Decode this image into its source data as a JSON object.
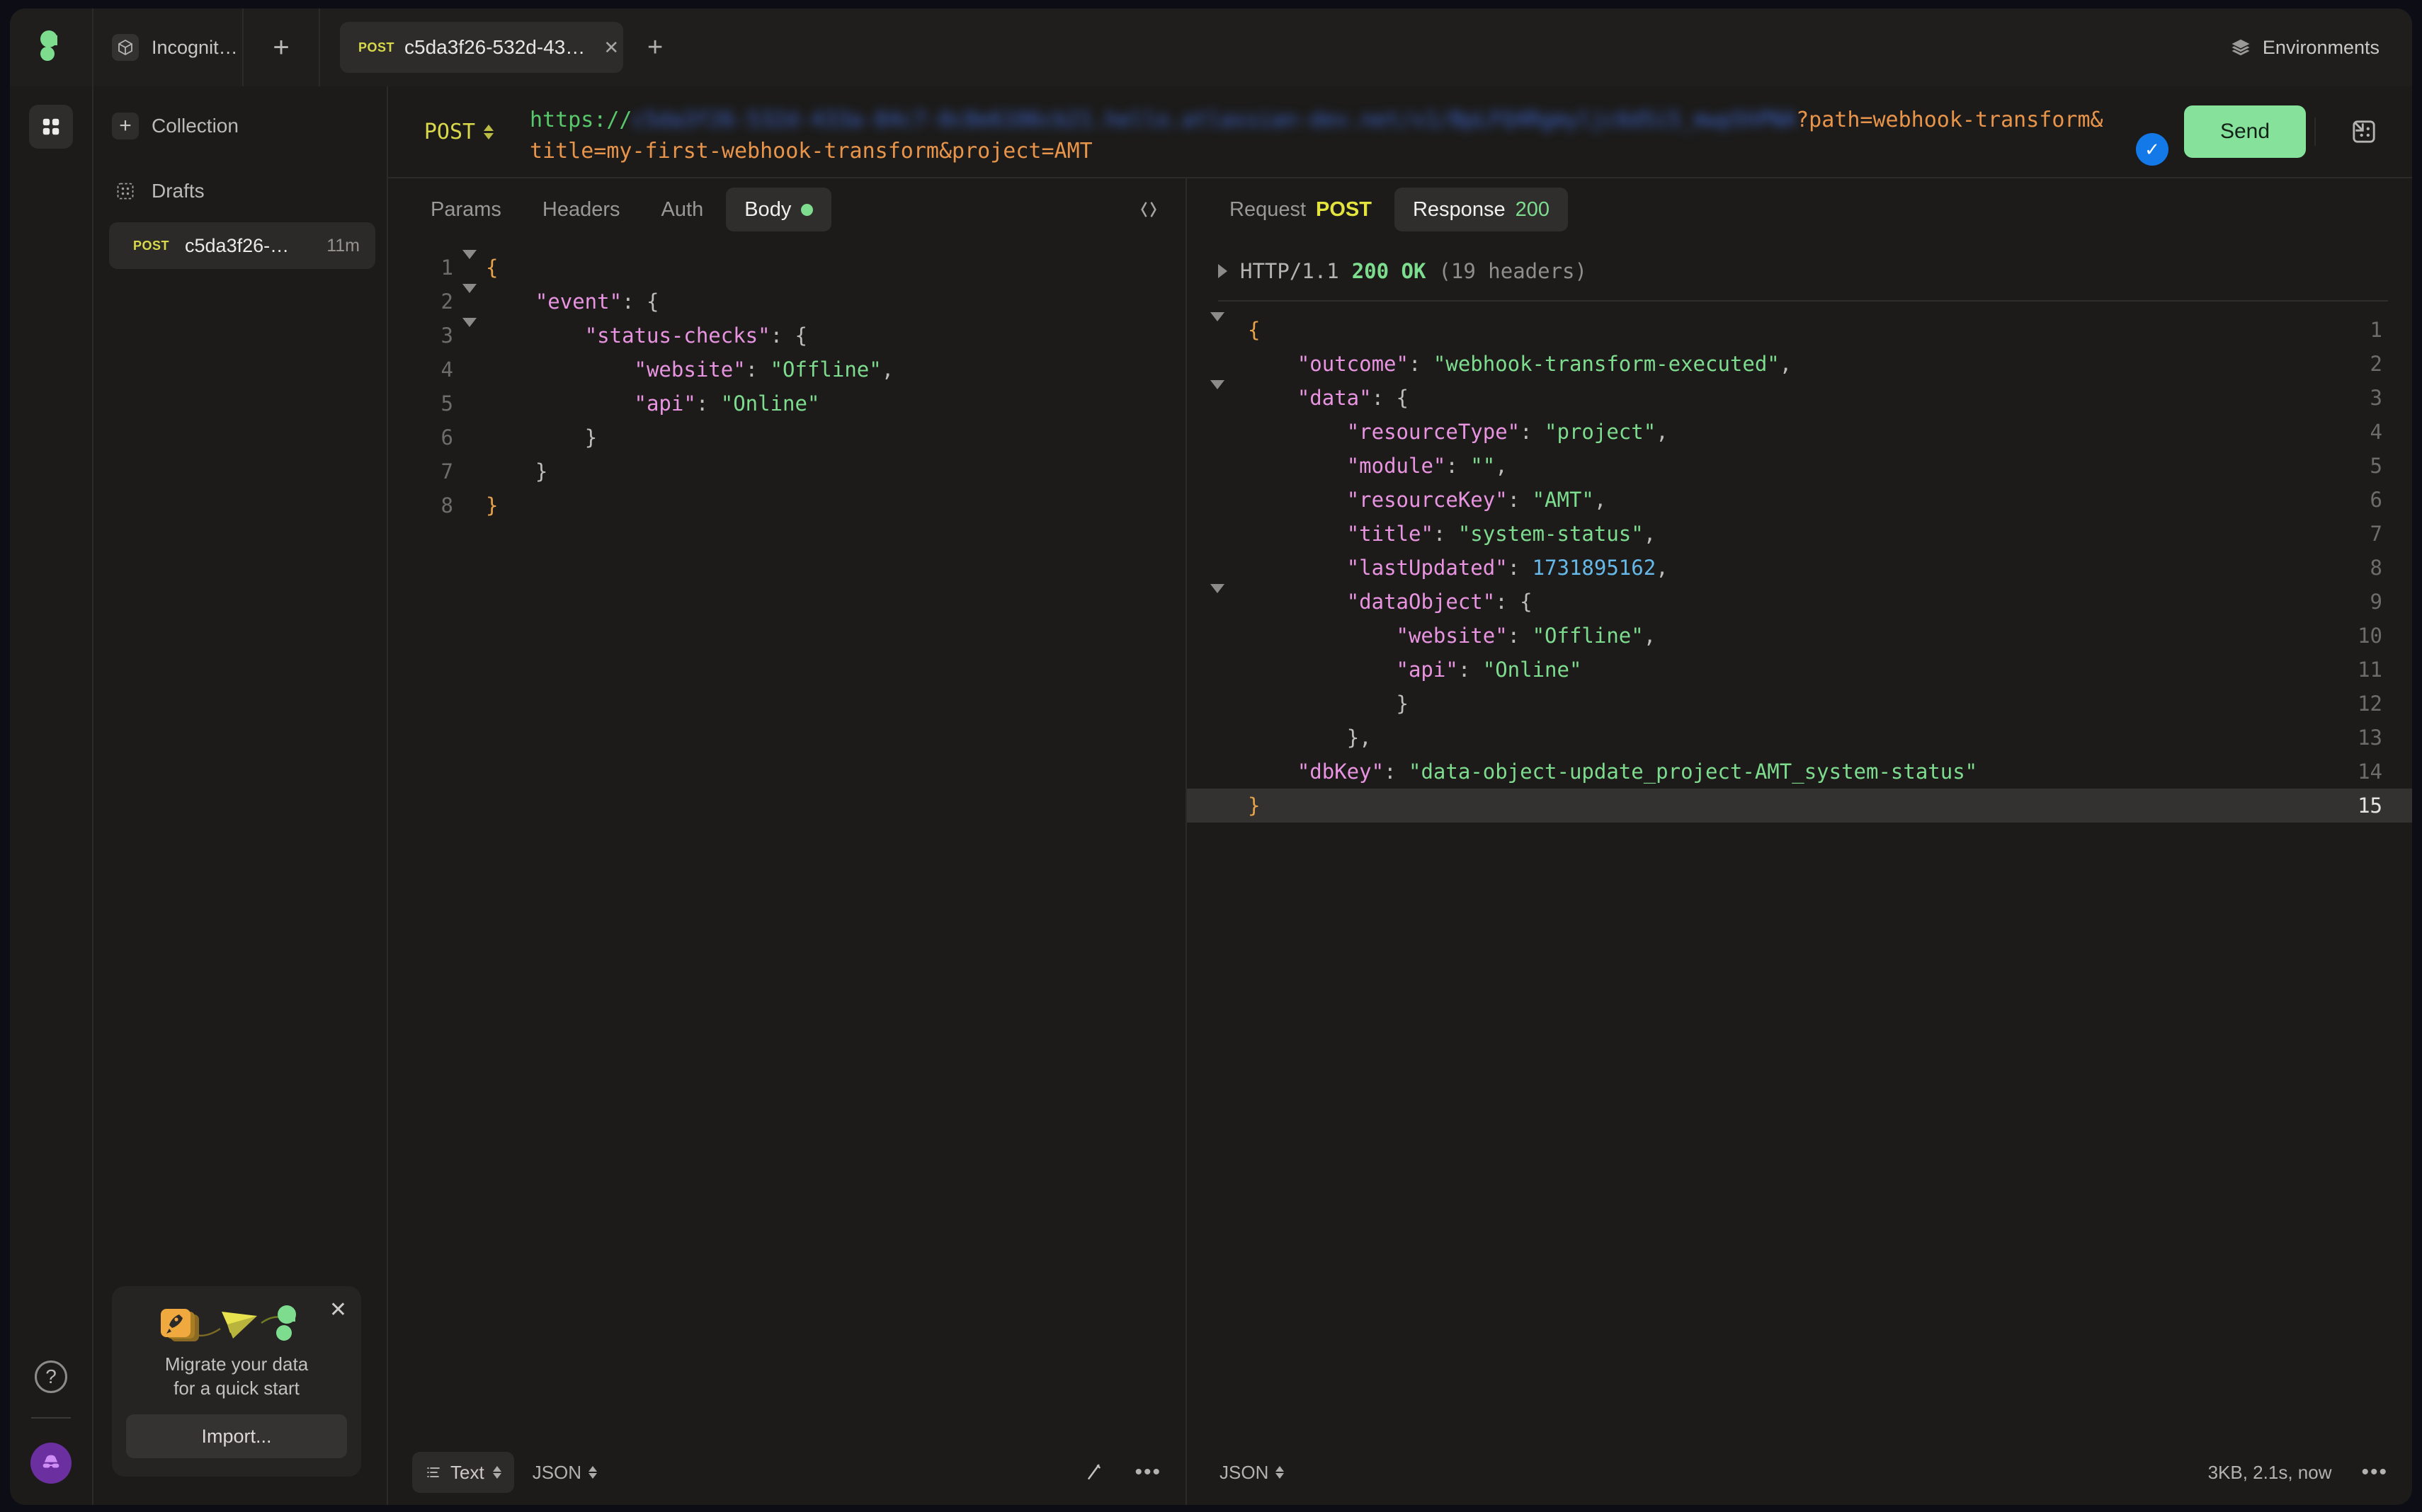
{
  "app": {
    "workspace_tab": "Incognito s...",
    "new_workspace_icon": "plus-icon",
    "environments_label": "Environments",
    "environments_icon": "layers-icon"
  },
  "request_tabs": {
    "tabs": [
      {
        "method": "POST",
        "title": "c5da3f26-532d-43…",
        "close_icon": "close-icon"
      }
    ],
    "new_tab_icon": "plus-icon"
  },
  "sidebar": {
    "new_collection_label": "Collection",
    "new_collection_icon": "plus-icon",
    "drafts_label": "Drafts",
    "drafts_icon": "drafts-grid-icon",
    "drafts": [
      {
        "method": "POST",
        "title": "c5da3f26-…",
        "age": "11m"
      }
    ],
    "migrate_card": {
      "close_icon": "close-icon",
      "line1": "Migrate your data",
      "line2": "for a quick start",
      "button": "Import..."
    }
  },
  "rail": {
    "apps_icon": "grid-apps-icon",
    "help_icon": "help-circle-icon",
    "avatar_icon": "incognito-avatar-icon"
  },
  "url_bar": {
    "method": "POST",
    "method_stepper_icon": "stepper-icon",
    "scheme": "https://",
    "host_redacted": "c5da3f26-532d-433a-84c7-0c8e6106cb21.hello.atlassian-dev.net/x1/BpLFQ4Rgmyljc6d5i5_mwp5hPNA",
    "query": "?path=webhook-transform&title=my-first-webhook-transform&project=AMT",
    "validation_icon": "check-circle-icon",
    "send_label": "Send",
    "split_view_icon": "split-panel-icon"
  },
  "request_pane": {
    "tabs": [
      {
        "label": "Params",
        "active": false
      },
      {
        "label": "Headers",
        "active": false
      },
      {
        "label": "Auth",
        "active": false
      },
      {
        "label": "Body",
        "active": true,
        "badge": "dot-green"
      }
    ],
    "code_icon": "code-brackets-icon",
    "body_lines": [
      {
        "num": "1",
        "fold": "down",
        "indent": 0,
        "tokens": [
          {
            "t": "{",
            "c": "b1"
          }
        ]
      },
      {
        "num": "2",
        "fold": "down",
        "indent": 1,
        "tokens": [
          {
            "t": "\"event\"",
            "c": "k"
          },
          {
            "t": ": ",
            "c": "p"
          },
          {
            "t": "{",
            "c": "p"
          }
        ]
      },
      {
        "num": "3",
        "fold": "down",
        "indent": 2,
        "tokens": [
          {
            "t": "\"status-checks\"",
            "c": "k"
          },
          {
            "t": ": ",
            "c": "p"
          },
          {
            "t": "{",
            "c": "p"
          }
        ]
      },
      {
        "num": "4",
        "fold": "",
        "indent": 3,
        "tokens": [
          {
            "t": "\"website\"",
            "c": "k"
          },
          {
            "t": ": ",
            "c": "p"
          },
          {
            "t": "\"Offline\"",
            "c": "s"
          },
          {
            "t": ",",
            "c": "p"
          }
        ]
      },
      {
        "num": "5",
        "fold": "",
        "indent": 3,
        "tokens": [
          {
            "t": "\"api\"",
            "c": "k"
          },
          {
            "t": ": ",
            "c": "p"
          },
          {
            "t": "\"Online\"",
            "c": "s"
          }
        ]
      },
      {
        "num": "6",
        "fold": "",
        "indent": 2,
        "tokens": [
          {
            "t": "}",
            "c": "p"
          }
        ]
      },
      {
        "num": "7",
        "fold": "",
        "indent": 1,
        "tokens": [
          {
            "t": "}",
            "c": "p"
          }
        ]
      },
      {
        "num": "8",
        "fold": "",
        "indent": 0,
        "tokens": [
          {
            "t": "}",
            "c": "b1"
          }
        ]
      }
    ],
    "footer": {
      "view_mode": "Text",
      "view_mode_icon": "list-lines-icon",
      "format": "JSON",
      "wand_icon": "magic-wand-icon",
      "more_icon": "more-dots-icon"
    }
  },
  "response_pane": {
    "tabs": [
      {
        "label": "Request",
        "suffix": "POST",
        "active": false
      },
      {
        "label": "Response",
        "suffix": "200",
        "active": true
      }
    ],
    "status_line": {
      "toggle_icon": "chevron-right-icon",
      "protocol": "HTTP/1.1",
      "code": "200 OK",
      "headers": "(19 headers)"
    },
    "body_lines": [
      {
        "num": "1",
        "fold": "down",
        "indent": 0,
        "tokens": [
          {
            "t": "{",
            "c": "b1"
          }
        ]
      },
      {
        "num": "2",
        "fold": "",
        "indent": 1,
        "tokens": [
          {
            "t": "\"outcome\"",
            "c": "k"
          },
          {
            "t": ": ",
            "c": "p"
          },
          {
            "t": "\"webhook-transform-executed\"",
            "c": "s"
          },
          {
            "t": ",",
            "c": "p"
          }
        ]
      },
      {
        "num": "3",
        "fold": "down",
        "indent": 1,
        "tokens": [
          {
            "t": "\"data\"",
            "c": "k"
          },
          {
            "t": ": ",
            "c": "p"
          },
          {
            "t": "{",
            "c": "p"
          }
        ]
      },
      {
        "num": "4",
        "fold": "",
        "indent": 2,
        "tokens": [
          {
            "t": "\"resourceType\"",
            "c": "k"
          },
          {
            "t": ": ",
            "c": "p"
          },
          {
            "t": "\"project\"",
            "c": "s"
          },
          {
            "t": ",",
            "c": "p"
          }
        ]
      },
      {
        "num": "5",
        "fold": "",
        "indent": 2,
        "tokens": [
          {
            "t": "\"module\"",
            "c": "k"
          },
          {
            "t": ": ",
            "c": "p"
          },
          {
            "t": "\"\"",
            "c": "s"
          },
          {
            "t": ",",
            "c": "p"
          }
        ]
      },
      {
        "num": "6",
        "fold": "",
        "indent": 2,
        "tokens": [
          {
            "t": "\"resourceKey\"",
            "c": "k"
          },
          {
            "t": ": ",
            "c": "p"
          },
          {
            "t": "\"AMT\"",
            "c": "s"
          },
          {
            "t": ",",
            "c": "p"
          }
        ]
      },
      {
        "num": "7",
        "fold": "",
        "indent": 2,
        "tokens": [
          {
            "t": "\"title\"",
            "c": "k"
          },
          {
            "t": ": ",
            "c": "p"
          },
          {
            "t": "\"system-status\"",
            "c": "s"
          },
          {
            "t": ",",
            "c": "p"
          }
        ]
      },
      {
        "num": "8",
        "fold": "",
        "indent": 2,
        "tokens": [
          {
            "t": "\"lastUpdated\"",
            "c": "k"
          },
          {
            "t": ": ",
            "c": "p"
          },
          {
            "t": "1731895162",
            "c": "n"
          },
          {
            "t": ",",
            "c": "p"
          }
        ]
      },
      {
        "num": "9",
        "fold": "down",
        "indent": 2,
        "tokens": [
          {
            "t": "\"dataObject\"",
            "c": "k"
          },
          {
            "t": ": ",
            "c": "p"
          },
          {
            "t": "{",
            "c": "p"
          }
        ]
      },
      {
        "num": "10",
        "fold": "",
        "indent": 3,
        "tokens": [
          {
            "t": "\"website\"",
            "c": "k"
          },
          {
            "t": ": ",
            "c": "p"
          },
          {
            "t": "\"Offline\"",
            "c": "s"
          },
          {
            "t": ",",
            "c": "p"
          }
        ]
      },
      {
        "num": "11",
        "fold": "",
        "indent": 3,
        "tokens": [
          {
            "t": "\"api\"",
            "c": "k"
          },
          {
            "t": ": ",
            "c": "p"
          },
          {
            "t": "\"Online\"",
            "c": "s"
          }
        ]
      },
      {
        "num": "12",
        "fold": "",
        "indent": 3,
        "tokens": [
          {
            "t": "}",
            "c": "p"
          }
        ]
      },
      {
        "num": "13",
        "fold": "",
        "indent": 2,
        "tokens": [
          {
            "t": "},",
            "c": "p"
          }
        ]
      },
      {
        "num": "14",
        "fold": "",
        "indent": 1,
        "tokens": [
          {
            "t": "\"dbKey\"",
            "c": "k"
          },
          {
            "t": ": ",
            "c": "p"
          },
          {
            "t": "\"data-object-update_project-AMT_system-status\"",
            "c": "s"
          }
        ]
      },
      {
        "num": "15",
        "fold": "",
        "indent": 0,
        "highlight": true,
        "tokens": [
          {
            "t": "}",
            "c": "b1"
          }
        ]
      }
    ],
    "footer": {
      "format": "JSON",
      "meta": "3KB, 2.1s, now",
      "more_icon": "more-dots-icon"
    }
  }
}
